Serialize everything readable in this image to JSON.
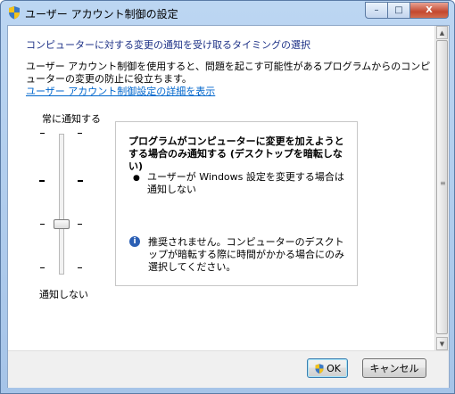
{
  "window": {
    "title": "ユーザー アカウント制御の設定",
    "controls": {
      "minimize": "–",
      "maximize": "□",
      "close": "X"
    }
  },
  "main": {
    "heading": "コンピューターに対する変更の通知を受け取るタイミングの選択",
    "description": "ユーザー アカウント制御を使用すると、問題を起こす可能性があるプログラムからのコンピューターの変更の防止に役立ちます。",
    "details_link": "ユーザー アカウント制御設定の詳細を表示"
  },
  "slider": {
    "top_label": "常に通知する",
    "bottom_label": "通知しない",
    "levels": 4,
    "selected_level": 2
  },
  "panel": {
    "title": "プログラムがコンピューターに変更を加えようとする場合のみ通知する (デスクトップを暗転しない)",
    "bullet_glyph": "●",
    "bullet": "ユーザーが Windows 設定を変更する場合は通知しない",
    "info_glyph": "i",
    "info": "推奨されません。コンピューターのデスクトップが暗転する際に時間がかかる場合にのみ選択してください。"
  },
  "scrollbar": {
    "up": "▲",
    "down": "▼",
    "grip": "≡"
  },
  "buttons": {
    "ok": "OK",
    "cancel": "キャンセル"
  },
  "icons": {
    "title": "uac-shield-icon",
    "ok": "uac-shield-icon",
    "info": "info-icon"
  }
}
